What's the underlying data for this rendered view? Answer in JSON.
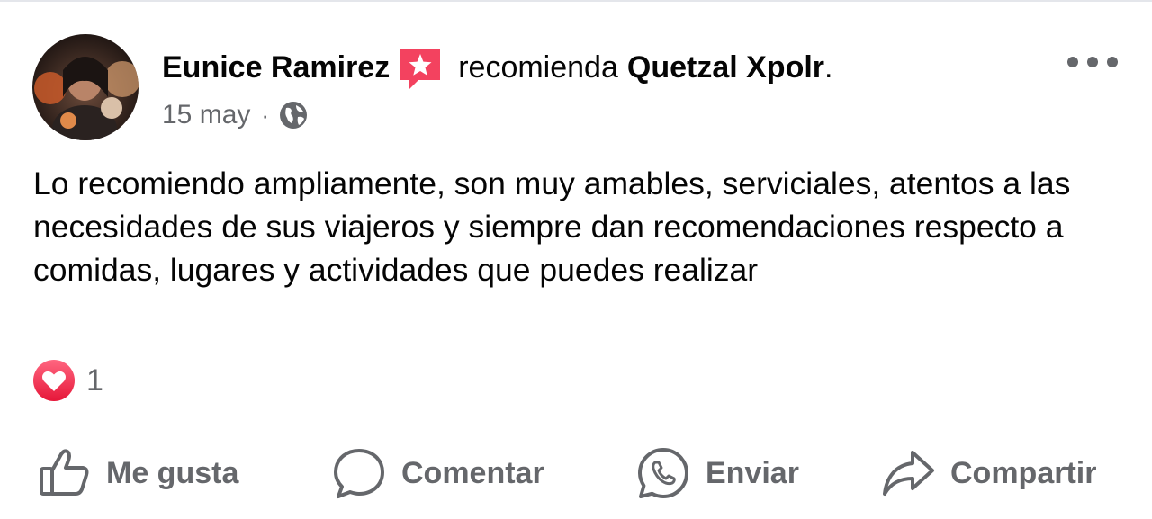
{
  "post": {
    "author": "Eunice Ramirez",
    "verb": "recomienda",
    "page_name": "Quetzal Xpolr",
    "period": ".",
    "date": "15 may",
    "separator": "·",
    "privacy_icon": "globe-icon",
    "badge_icon": "recommendation-star-icon",
    "more_icon": "more-options-icon",
    "text": "Lo recomiendo ampliamente, son muy amables, serviciales, atentos a las necesidades de sus viajeros y siempre dan recomendaciones respecto a comidas, lugares y actividades que puedes realizar"
  },
  "reactions": {
    "icon": "love-reaction-icon",
    "count": "1"
  },
  "actions": {
    "like": {
      "label": "Me gusta",
      "icon": "thumbs-up-icon"
    },
    "comment": {
      "label": "Comentar",
      "icon": "comment-bubble-icon"
    },
    "send": {
      "label": "Enviar",
      "icon": "whatsapp-icon"
    },
    "share": {
      "label": "Compartir",
      "icon": "share-arrow-icon"
    }
  },
  "colors": {
    "text_primary": "#050505",
    "text_secondary": "#65676b",
    "badge": "#f3425f",
    "love": "#f33e58",
    "divider": "#e4e6eb"
  }
}
